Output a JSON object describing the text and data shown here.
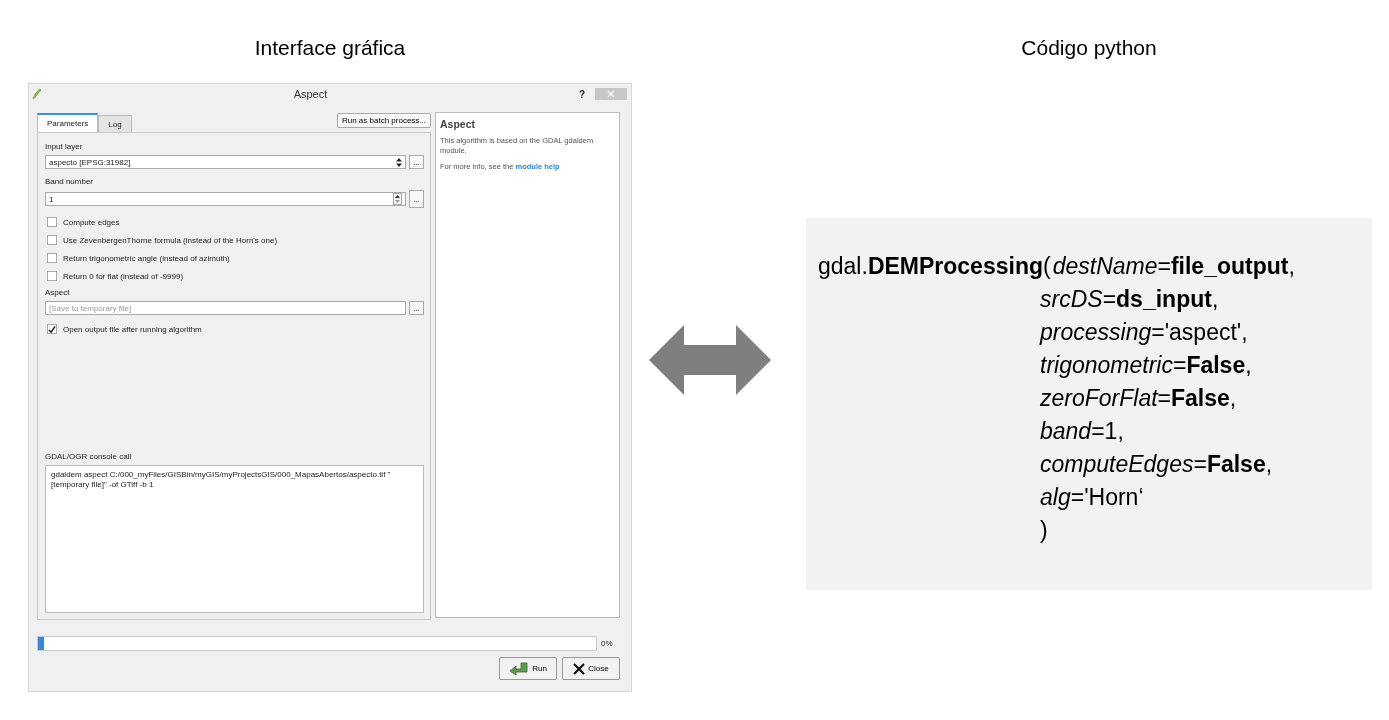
{
  "headings": [
    "Interface gráfica",
    "Código python"
  ],
  "dialog": {
    "title": "Aspect",
    "help_button": "?",
    "tabs": [
      {
        "label": "Parameters",
        "selected": true
      },
      {
        "label": "Log",
        "selected": false
      }
    ],
    "batch_button": "Run as batch process...",
    "parameters": [
      {
        "kind": "label",
        "text": "Input layer"
      },
      {
        "kind": "select",
        "value": "aspecto [EPSG:31982]",
        "browse": "..."
      },
      {
        "kind": "label",
        "text": "Band number"
      },
      {
        "kind": "spin",
        "value": "1",
        "browse": "..."
      },
      {
        "kind": "checkbox",
        "label": "Compute edges",
        "checked": false
      },
      {
        "kind": "checkbox",
        "label": "Use ZevenbergenThorne formula (instead of the Horn's one)",
        "checked": false
      },
      {
        "kind": "checkbox",
        "label": "Return trigonometric angle (instead of azimuth)",
        "checked": false
      },
      {
        "kind": "checkbox",
        "label": "Return 0 for flat (instead of -9999)",
        "checked": false
      },
      {
        "kind": "label",
        "text": "Aspect"
      },
      {
        "kind": "file",
        "placeholder": "[Save to temporary file]",
        "browse": "..."
      },
      {
        "kind": "checkbox",
        "label": "Open output file after running algorithm",
        "checked": true
      }
    ],
    "console_label": "GDAL/OGR console call",
    "console_text": "gdaldem aspect C:/000_myFiles/GISBin/myGIS/myProjectsGIS/000_MapasAbertos/aspecto.tif \"[temporary file]\" -of GTiff -b 1",
    "help": {
      "title": "Aspect",
      "text": "This algorithm is based on the GDAL gdaldem module.",
      "more_prefix": "For more info, see the",
      "link": "module help"
    },
    "progress": {
      "level": 0.01,
      "reading": "0%"
    },
    "buttons": [
      {
        "kind": "run",
        "label": "Run"
      },
      {
        "kind": "close",
        "label": "Close"
      }
    ]
  },
  "code": {
    "call": "gdal.**DEMProcessing**(",
    "args": [
      "*destName*=**file_output**,",
      "*srcDS*=**ds_input**,",
      "*processing*='aspect',",
      "*trigonometric*=**False**,",
      "*zeroForFlat*=**False**,",
      "*band*=1,",
      "*computeEdges*=**False**,",
      "*alg*='Horn‘",
      ")"
    ]
  }
}
